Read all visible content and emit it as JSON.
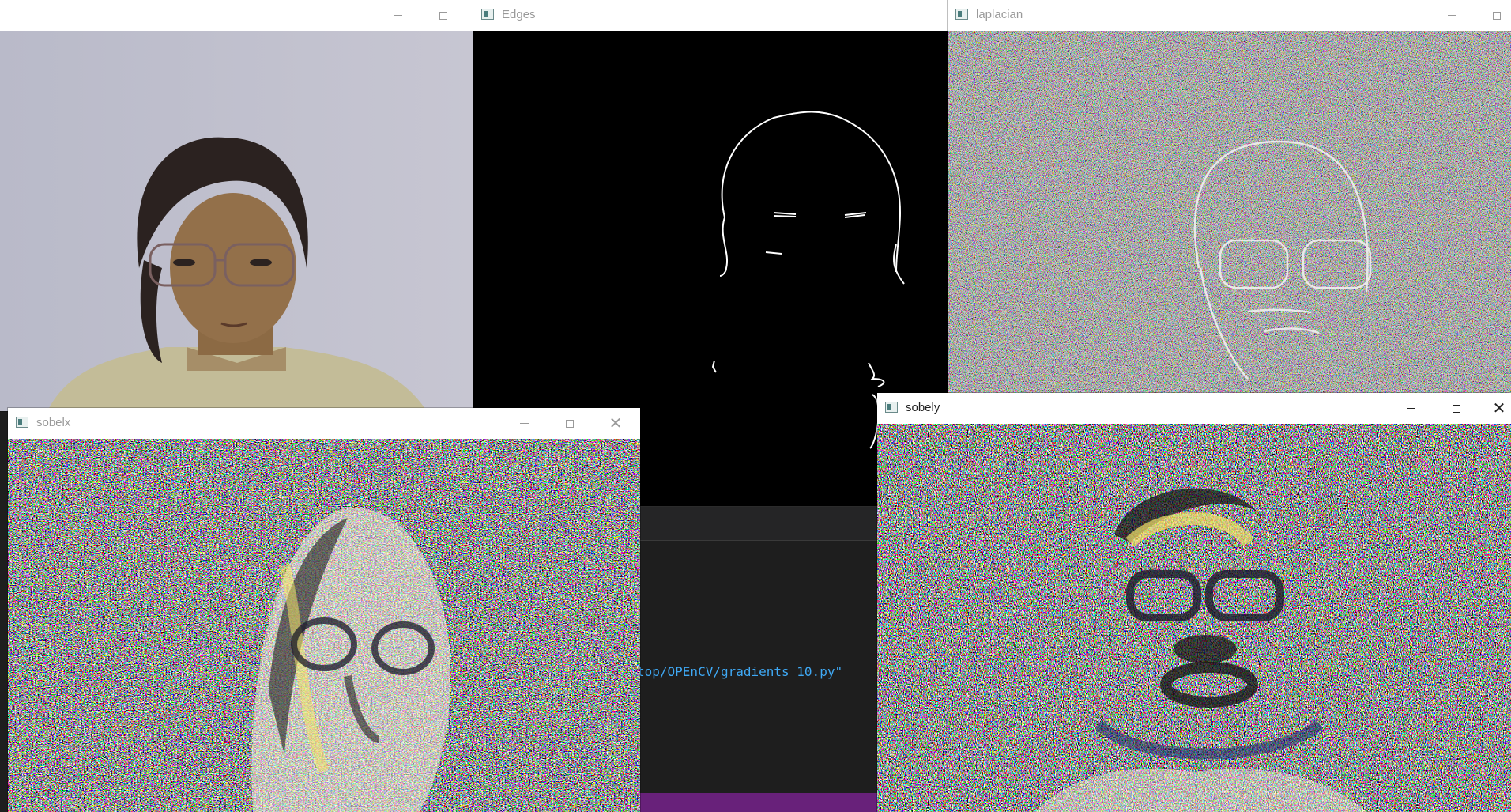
{
  "windows": {
    "camera": {
      "title": ""
    },
    "edges": {
      "title": "Edges"
    },
    "laplacian": {
      "title": "laplacian"
    },
    "sobelx": {
      "title": "sobelx"
    },
    "sobely": {
      "title": "sobely"
    }
  },
  "window_controls": {
    "minimize": "minimize-icon",
    "maximize": "maximize-icon",
    "close": "close-icon"
  },
  "terminal": {
    "command_fragment": "top/OPEnCV/gradients 10.py\""
  },
  "colors": {
    "terminal_bg": "#1e1e1e",
    "status_bar": "#68217a",
    "path_text": "#3fa9f5",
    "edge_bg": "#000000",
    "edge_line": "#ffffff"
  }
}
